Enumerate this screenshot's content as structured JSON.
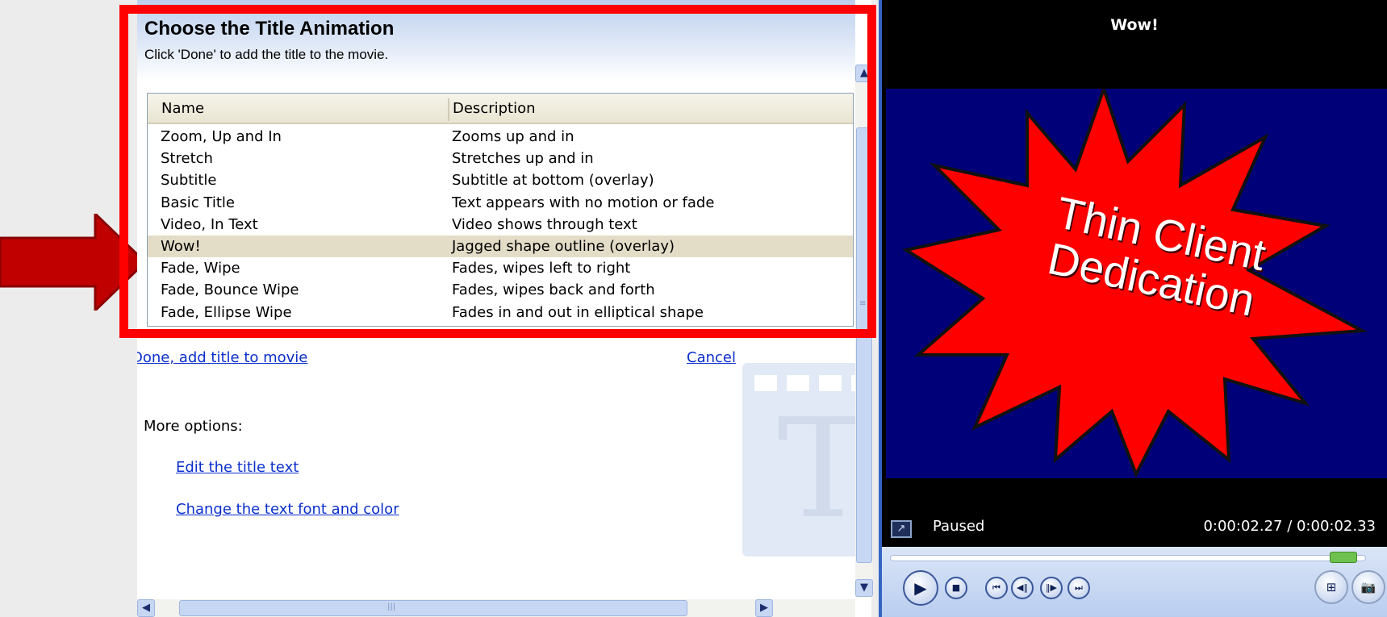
{
  "pane": {
    "title": "Choose the Title Animation",
    "subtitle": "Click 'Done' to add the title to the movie.",
    "columns": {
      "name": "Name",
      "description": "Description"
    },
    "rows": [
      {
        "name": "Zoom, Up and In",
        "description": "Zooms up and in"
      },
      {
        "name": "Stretch",
        "description": "Stretches up and in"
      },
      {
        "name": "Subtitle",
        "description": "Subtitle at bottom (overlay)"
      },
      {
        "name": "Basic Title",
        "description": "Text appears with no motion or fade"
      },
      {
        "name": "Video, In Text",
        "description": "Video shows through text"
      },
      {
        "name": "Wow!",
        "description": "Jagged shape outline (overlay)",
        "selected": true
      },
      {
        "name": "Fade, Wipe",
        "description": "Fades, wipes left to right"
      },
      {
        "name": "Fade, Bounce Wipe",
        "description": "Fades, wipes back and forth"
      },
      {
        "name": "Fade, Ellipse Wipe",
        "description": "Fades in and out in elliptical shape"
      }
    ],
    "done_link": "Done, add title to movie",
    "cancel_link": "Cancel",
    "more_options_label": "More options:",
    "edit_text_link": "Edit the title text",
    "font_color_link": "Change the text font and color"
  },
  "player": {
    "title": "Wow!",
    "video_text_line1": "Thin Client",
    "video_text_line2": "Dedication",
    "status": "Paused",
    "time": "0:00:02.27 / 0:00:02.33",
    "seek_fraction": 0.97
  },
  "icons": {
    "scroll_up": "▲",
    "scroll_down": "▼",
    "scroll_left": "◀",
    "scroll_right": "▶",
    "play": "▶",
    "stop": "■",
    "prev": "⏮",
    "back_frame": "◀‖",
    "forward_frame": "‖▶",
    "next": "⏭",
    "split": "⊞",
    "snapshot": "📷"
  },
  "colors": {
    "highlight": "#ff0000",
    "selected_row": "#e3ddc7",
    "video_bg": "#000078",
    "starburst": "#ff0000",
    "link": "#0b2fcc"
  }
}
